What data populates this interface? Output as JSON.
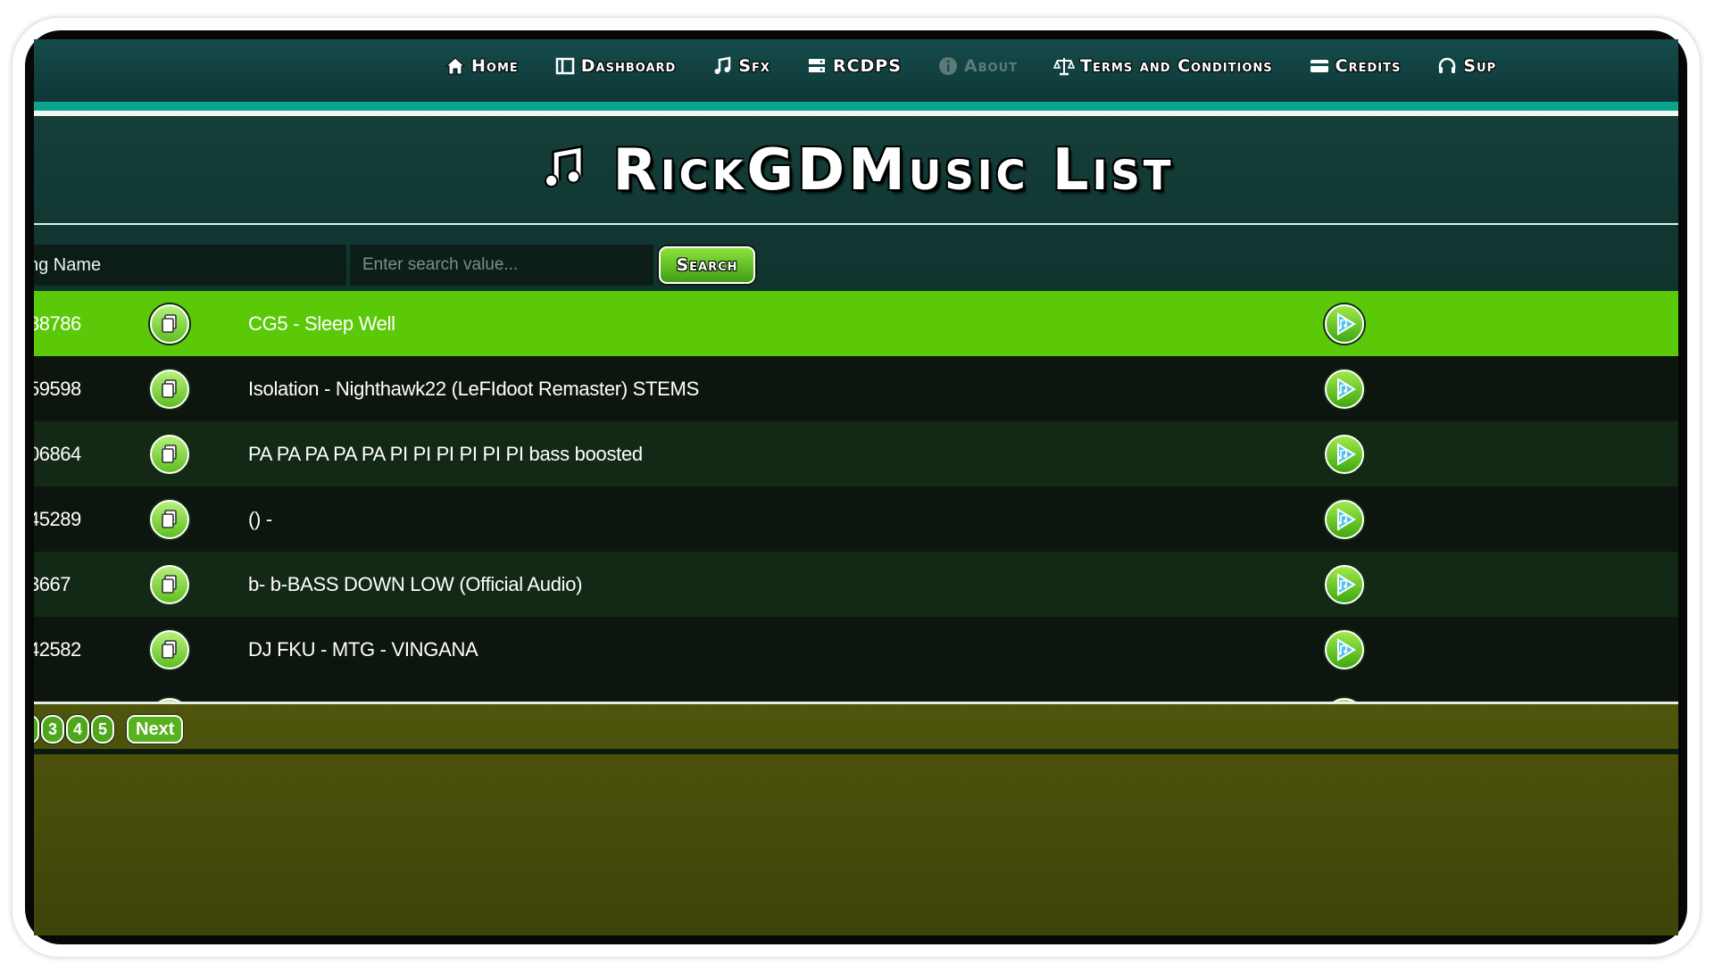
{
  "nav": {
    "items": [
      {
        "label": "Home",
        "icon": "home-icon"
      },
      {
        "label": "Dashboard",
        "icon": "dashboard-icon"
      },
      {
        "label": "Sfx",
        "icon": "music-note-icon"
      },
      {
        "label": "RCDPS",
        "icon": "server-icon"
      },
      {
        "label": "About",
        "icon": "info-icon"
      },
      {
        "label": "Terms and Conditions",
        "icon": "scale-icon"
      },
      {
        "label": "Credits",
        "icon": "card-icon"
      },
      {
        "label": "Sup",
        "icon": "headset-icon"
      }
    ]
  },
  "header": {
    "title": "RickGDMusic List",
    "icon": "music-note-icon"
  },
  "search": {
    "field_label": "ng Name",
    "placeholder": "Enter search value...",
    "button_label": "Search"
  },
  "table": {
    "rows": [
      {
        "id": "88786",
        "name": "CG5 - Sleep Well"
      },
      {
        "id": "59598",
        "name": "Isolation - Nighthawk22 (LeFIdoot Remaster) STEMS"
      },
      {
        "id": "06864",
        "name": "PA PA PA PA PA PI PI PI PI PI PI bass boosted"
      },
      {
        "id": "45289",
        "name": "() -"
      },
      {
        "id": "3667",
        "name": "b- b-BASS DOWN LOW (Official Audio)"
      },
      {
        "id": "42582",
        "name": "DJ FKU - MTG - VINGANA"
      }
    ]
  },
  "pagination": {
    "pages": [
      "3",
      "4",
      "5"
    ],
    "next_label": "Next"
  },
  "colors": {
    "active_row": "#5bc908",
    "nav_bg": "#154b4b",
    "accent": "#0aa58c",
    "footer_bg": "#4f550b"
  }
}
